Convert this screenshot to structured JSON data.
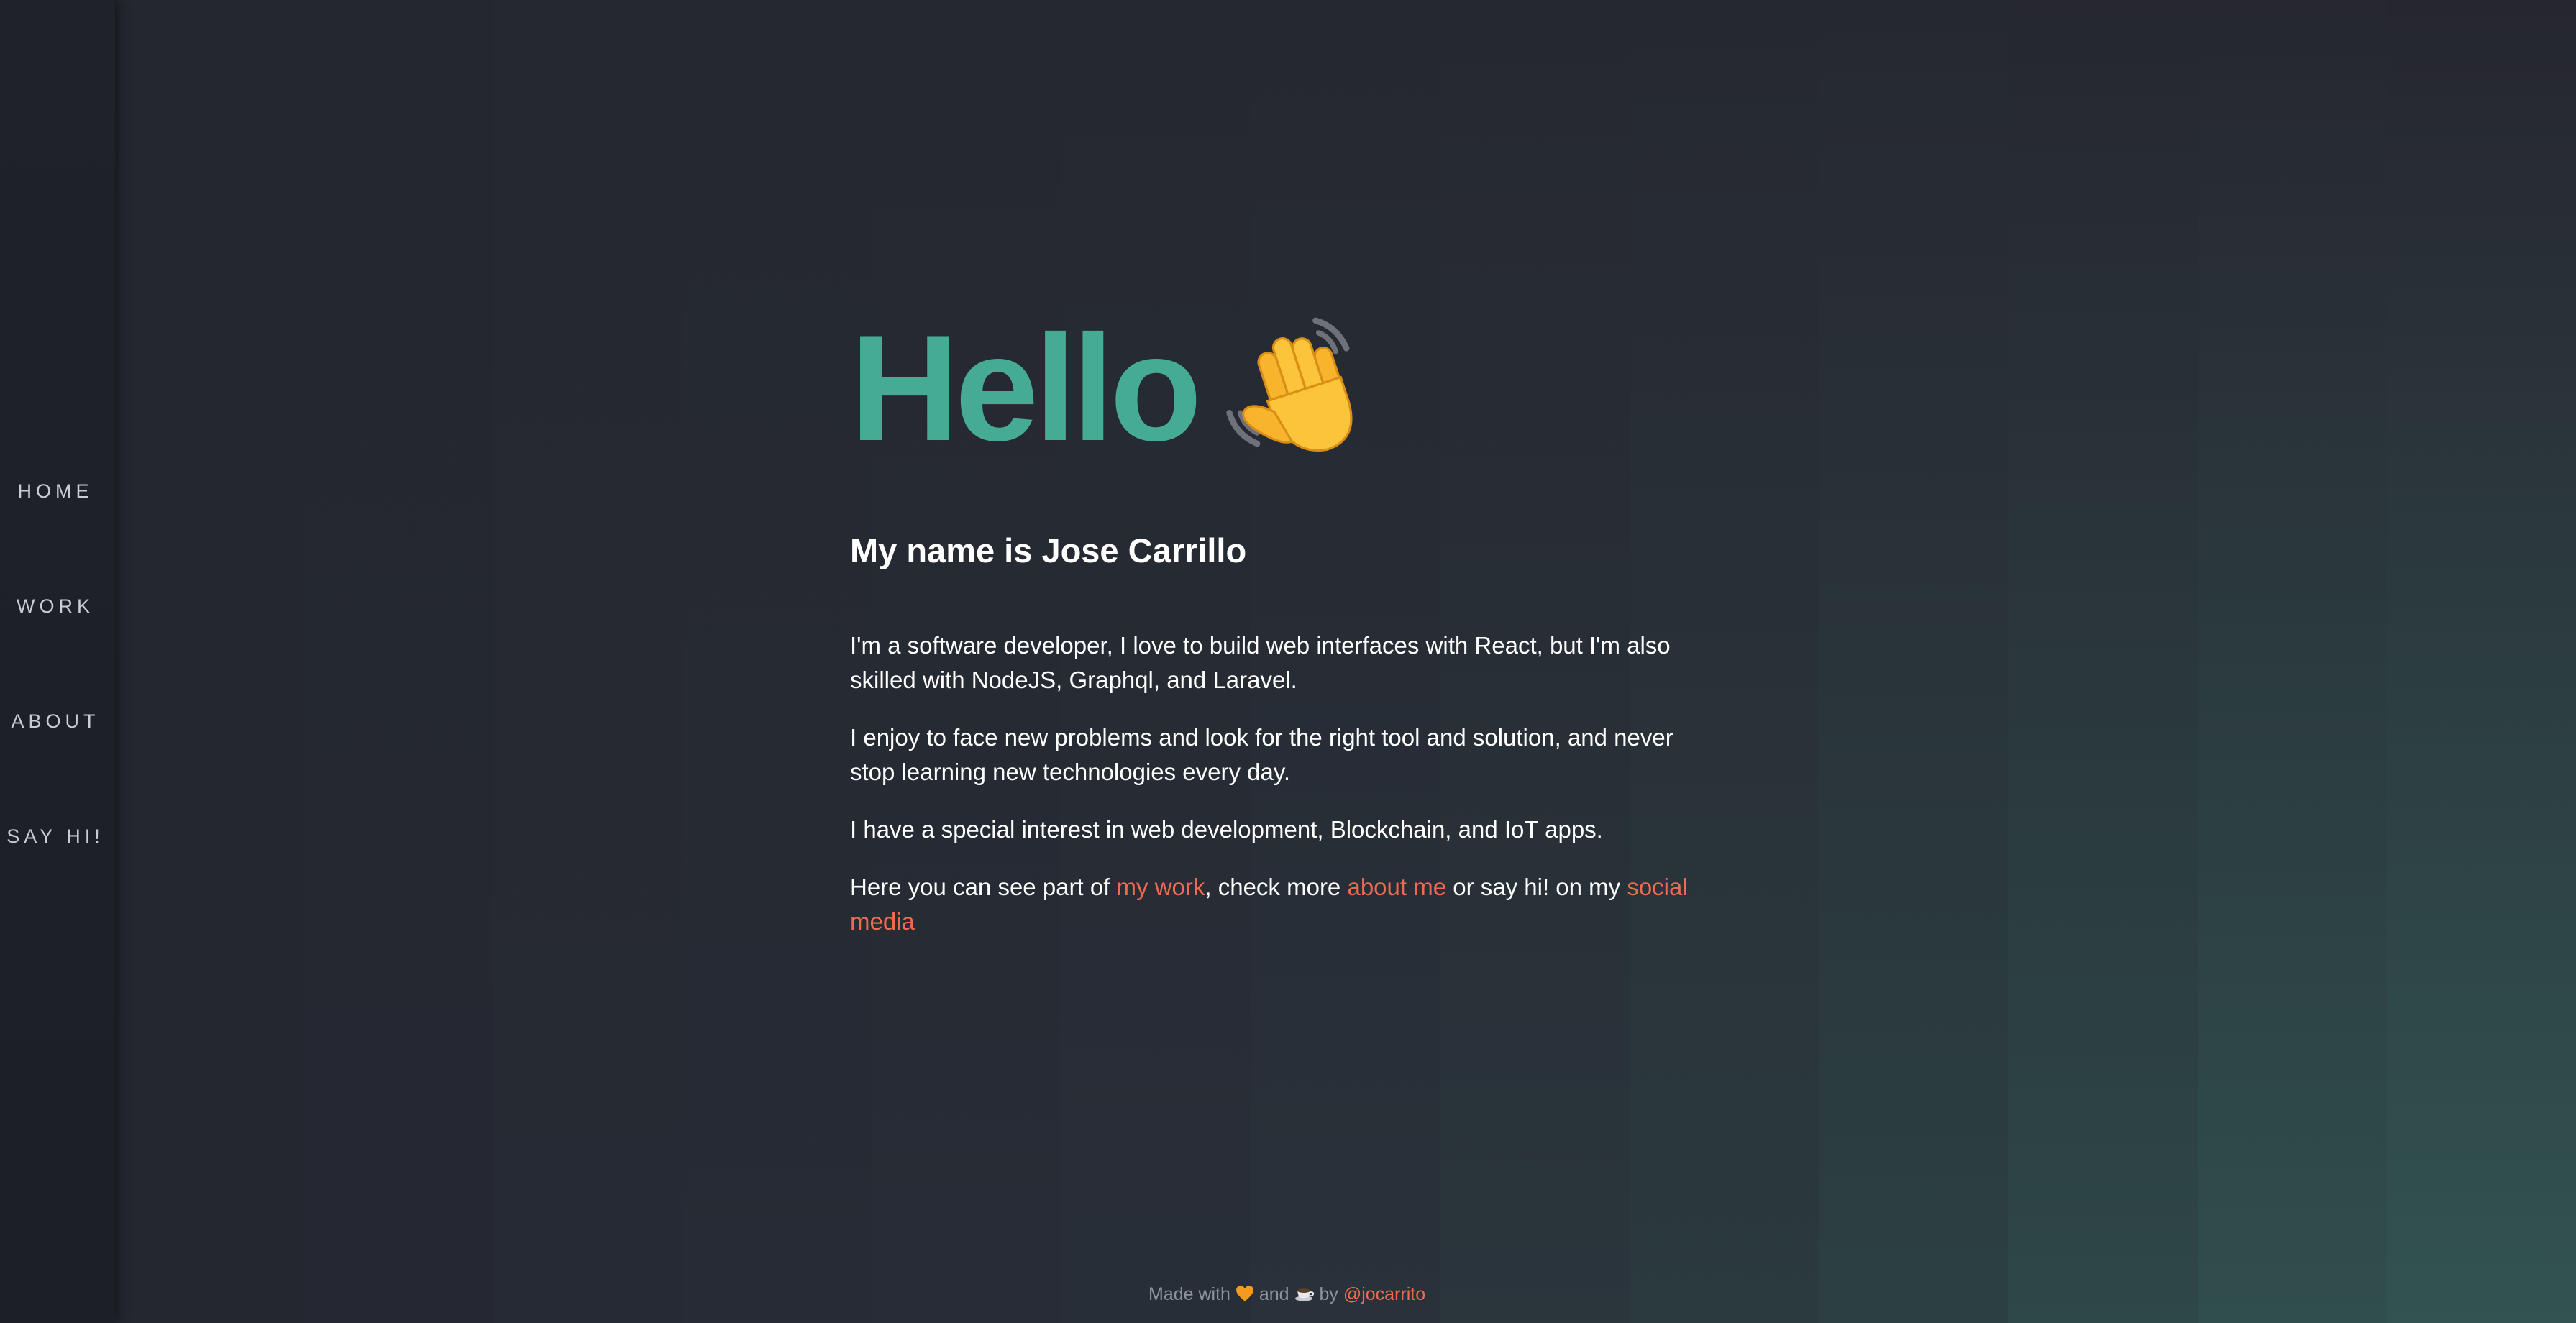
{
  "nav": {
    "items": [
      {
        "label": "HOME"
      },
      {
        "label": "WORK"
      },
      {
        "label": "ABOUT"
      },
      {
        "label": "SAY HI!"
      }
    ]
  },
  "hero": {
    "greeting": "Hello",
    "greeting_icon": "waving-hand-icon",
    "name_line": "My name is Jose Carrillo"
  },
  "intro": {
    "p1": "I'm a software developer, I love to build web interfaces with React, but I'm also skilled with NodeJS, Graphql, and Laravel.",
    "p2": "I enjoy to face new problems and look for the right tool and solution, and never stop learning new technologies every day.",
    "p3": "I have a special interest in web development, Blockchain, and IoT apps.",
    "p4_prefix": "Here you can see part of ",
    "p4_link_work": "my work",
    "p4_mid": ", check more ",
    "p4_link_about": "about me",
    "p4_mid2": " or say hi! on my ",
    "p4_link_social": "social media"
  },
  "footer": {
    "prefix": "Made with",
    "heart_icon": "orange-heart-icon",
    "and": "and",
    "cup_icon": "coffee-cup-icon",
    "by": "by",
    "handle": "@jocarrito"
  },
  "colors": {
    "accent_green": "#45ab94",
    "link_coral": "#ef6a52",
    "background": "#242730",
    "sidebar": "#1e2128"
  }
}
